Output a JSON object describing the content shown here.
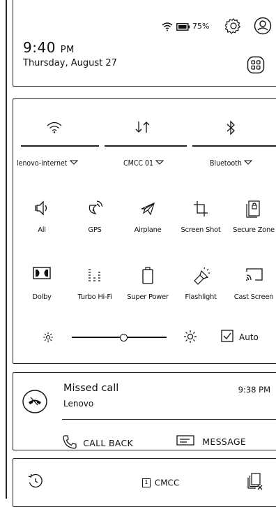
{
  "status": {
    "battery_percent": "75%",
    "icons": [
      "wifi-icon",
      "battery-icon",
      "settings-gear-icon",
      "user-account-icon"
    ]
  },
  "header": {
    "time": "9:40",
    "ampm": "PM",
    "date": "Thursday, August 27",
    "edit_icon": "grid-edit-icon"
  },
  "quick_toggles": [
    {
      "icon": "wifi-icon",
      "label": "lenovo-internet",
      "has_dropdown": true
    },
    {
      "icon": "mobile-data-icon",
      "label": "CMCC 01",
      "has_dropdown": true
    },
    {
      "icon": "bluetooth-icon",
      "label": "Bluetooth",
      "has_dropdown": true
    }
  ],
  "tiles_row1": [
    {
      "icon": "sound-icon",
      "label": "All"
    },
    {
      "icon": "gps-icon",
      "label": "GPS"
    },
    {
      "icon": "airplane-icon",
      "label": "Airplane"
    },
    {
      "icon": "screenshot-icon",
      "label": "Screen Shot"
    },
    {
      "icon": "secure-zone-icon",
      "label": "Secure Zone"
    }
  ],
  "tiles_row2": [
    {
      "icon": "dolby-icon",
      "label": "Dolby"
    },
    {
      "icon": "hifi-icon",
      "label": "Turbo Hi-Fi"
    },
    {
      "icon": "battery-saver-icon",
      "label": "Super Power"
    },
    {
      "icon": "flashlight-icon",
      "label": "Flashlight"
    },
    {
      "icon": "cast-icon",
      "label": "Cast Screen"
    }
  ],
  "brightness": {
    "level": 0.55,
    "auto_label": "Auto",
    "auto_checked": true
  },
  "notification": {
    "title": "Missed call",
    "caller": "Lenovo",
    "time": "9:38 PM",
    "actions": [
      "CALL BACK",
      "MESSAGE"
    ]
  },
  "bottom_bar": {
    "carrier": "CMCC",
    "sim_number": "1"
  }
}
